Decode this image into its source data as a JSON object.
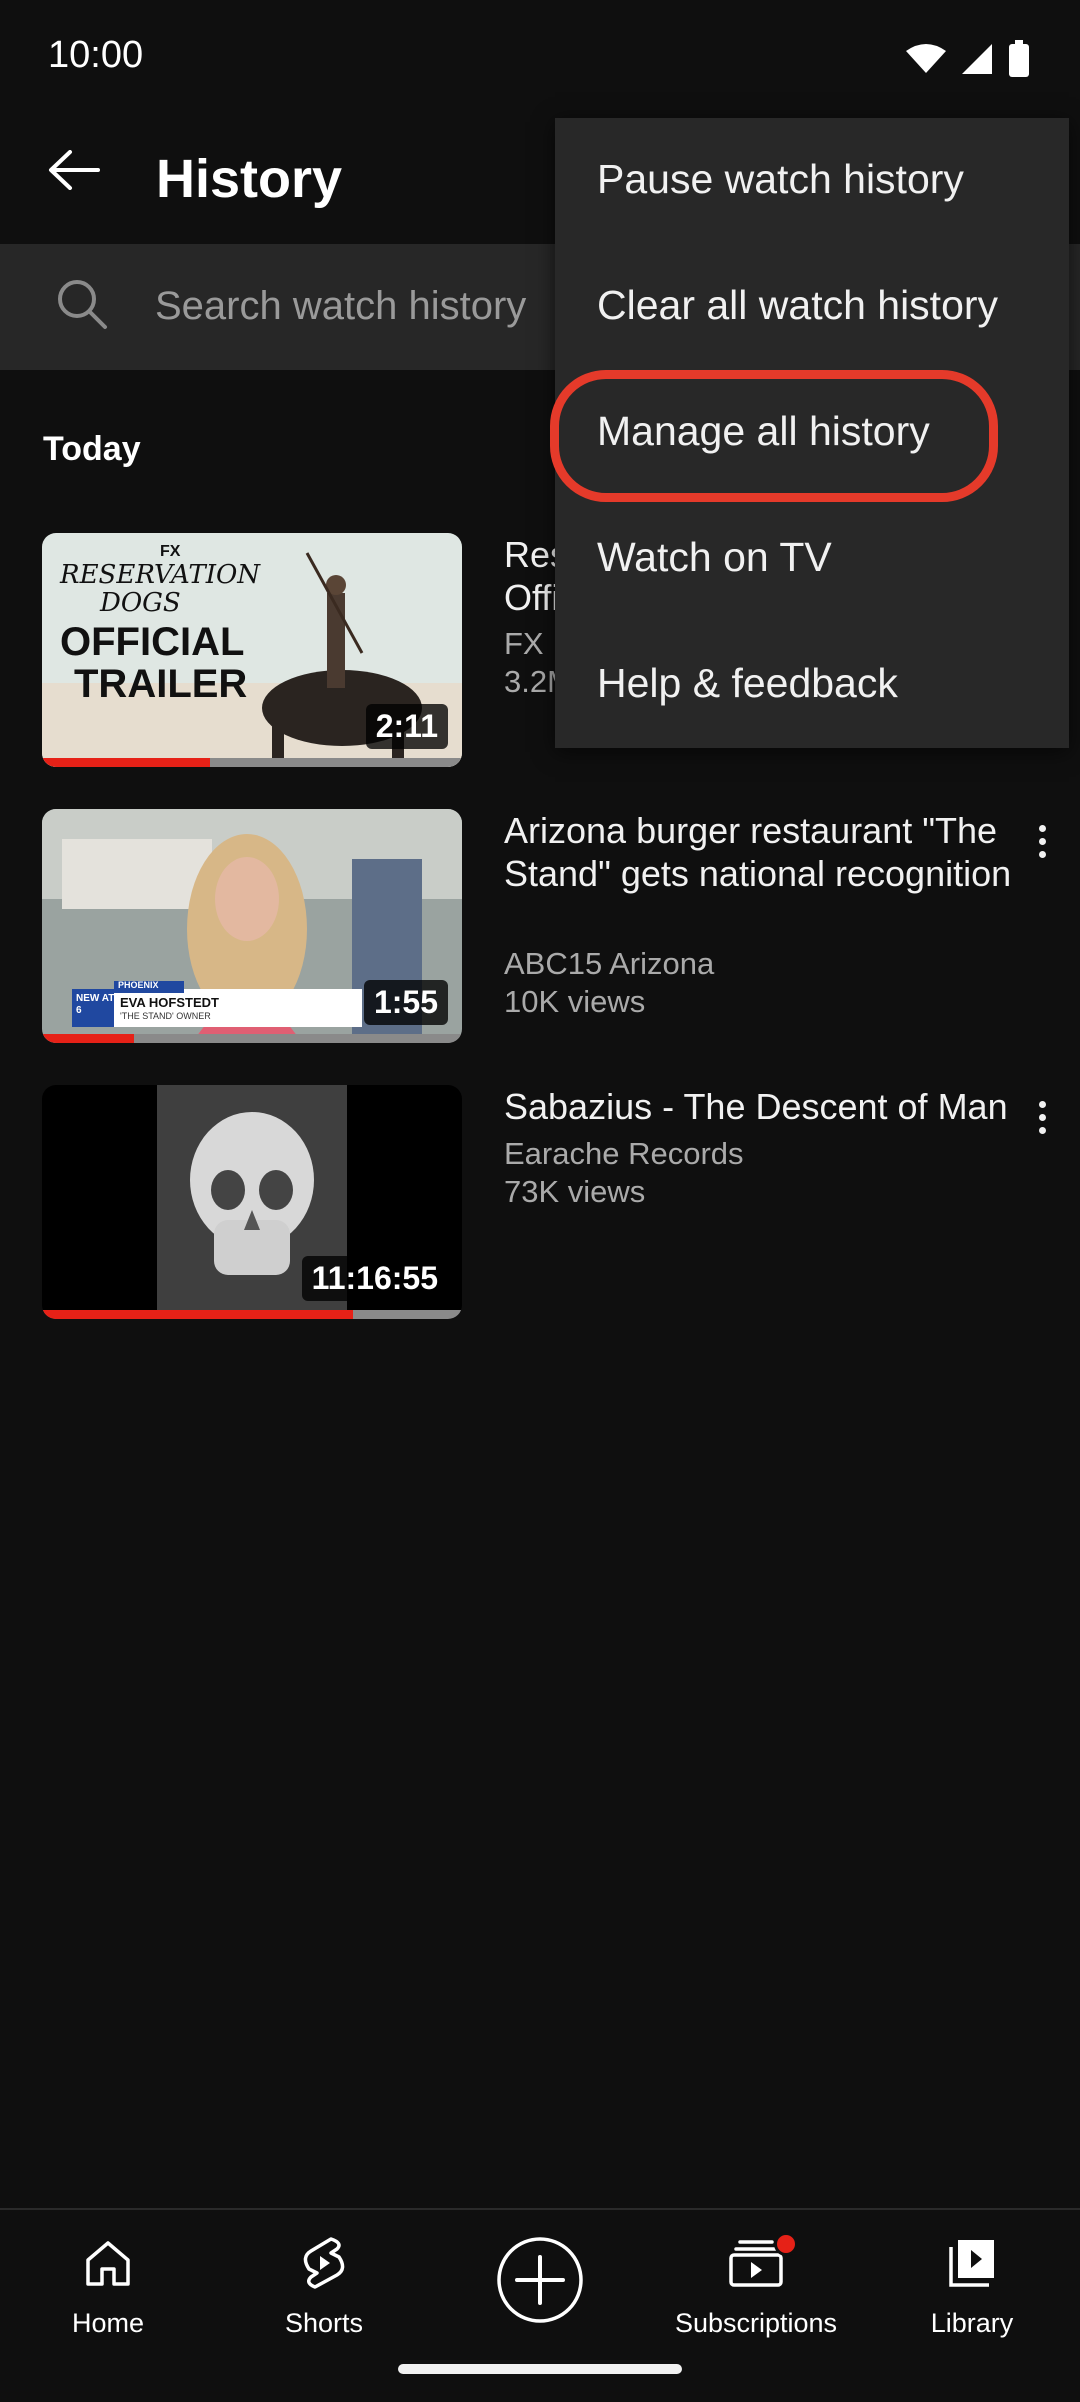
{
  "status_bar": {
    "time": "10:00",
    "icons": [
      "wifi-icon",
      "signal-icon",
      "battery-icon"
    ]
  },
  "app_bar": {
    "back_icon": "arrow-left-icon",
    "title": "History"
  },
  "search": {
    "placeholder": "Search watch history",
    "icon": "search-icon"
  },
  "section": {
    "label": "Today"
  },
  "videos": [
    {
      "title_visible": "Res\nOffi",
      "channel_visible": "FX I",
      "views_visible": "3.2M",
      "duration": "2:11",
      "thumbnail_text": [
        "FX",
        "RESERVATION",
        "DOGS",
        "OFFICIAL",
        "TRAILER"
      ],
      "progress_fraction": 0.4
    },
    {
      "title": "Arizona burger restaurant \"The Stand\" gets national recognition",
      "channel": "ABC15 Arizona",
      "views": "10K views",
      "duration": "1:55",
      "thumbnail_text": [
        "PHOENIX",
        "NEW AT 6",
        "EVA HOFSTEDT",
        "'THE STAND' OWNER"
      ],
      "progress_fraction": 0.22
    },
    {
      "title": "Sabazius - The Descent of Man",
      "channel": "Earache Records",
      "views": "73K views",
      "duration": "11:16:55",
      "progress_fraction": 0.74
    }
  ],
  "menu": {
    "items": [
      {
        "label": "Pause watch history"
      },
      {
        "label": "Clear all watch history"
      },
      {
        "label": "Manage all history",
        "highlighted": true
      },
      {
        "label": "Watch on TV"
      },
      {
        "label": "Help & feedback"
      }
    ],
    "highlight_color": "#e53a2a"
  },
  "bottom_nav": {
    "items": [
      {
        "label": "Home",
        "icon": "home-icon"
      },
      {
        "label": "Shorts",
        "icon": "shorts-icon"
      },
      {
        "label": "",
        "icon": "create-plus-icon"
      },
      {
        "label": "Subscriptions",
        "icon": "subscriptions-icon",
        "badge": true
      },
      {
        "label": "Library",
        "icon": "library-icon"
      }
    ]
  },
  "colors": {
    "background": "#0f0f0f",
    "accent_red": "#e62117",
    "menu_bg": "#282828"
  }
}
